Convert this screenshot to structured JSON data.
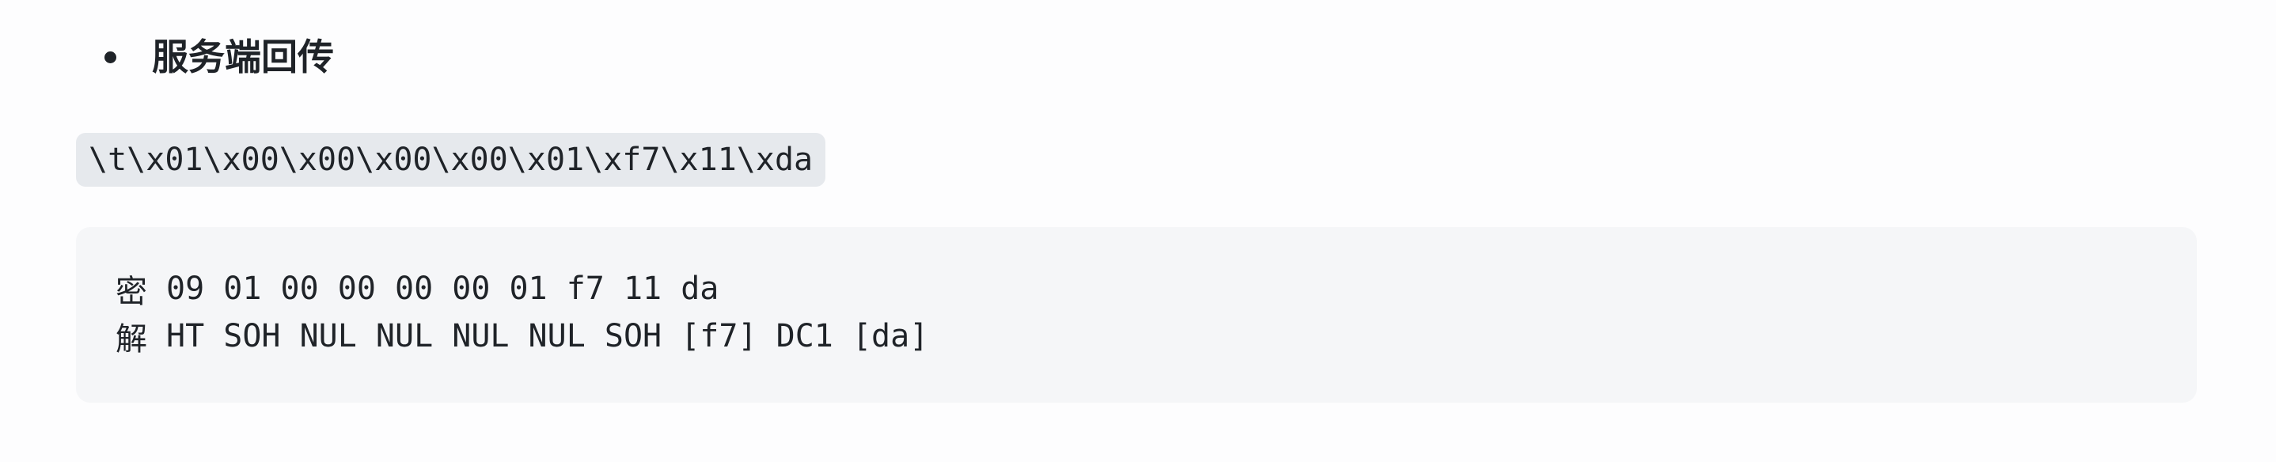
{
  "list": {
    "item_text": "服务端回传"
  },
  "inline_code": "\\t\\x01\\x00\\x00\\x00\\x00\\x01\\xf7\\x11\\xda",
  "code_block": {
    "lines": [
      {
        "prefix": "密",
        "text": "09 01 00 00 00 00 01 f7 11 da"
      },
      {
        "prefix": "解",
        "text": "HT SOH NUL NUL NUL NUL SOH [f7] DC1 [da]"
      }
    ]
  }
}
